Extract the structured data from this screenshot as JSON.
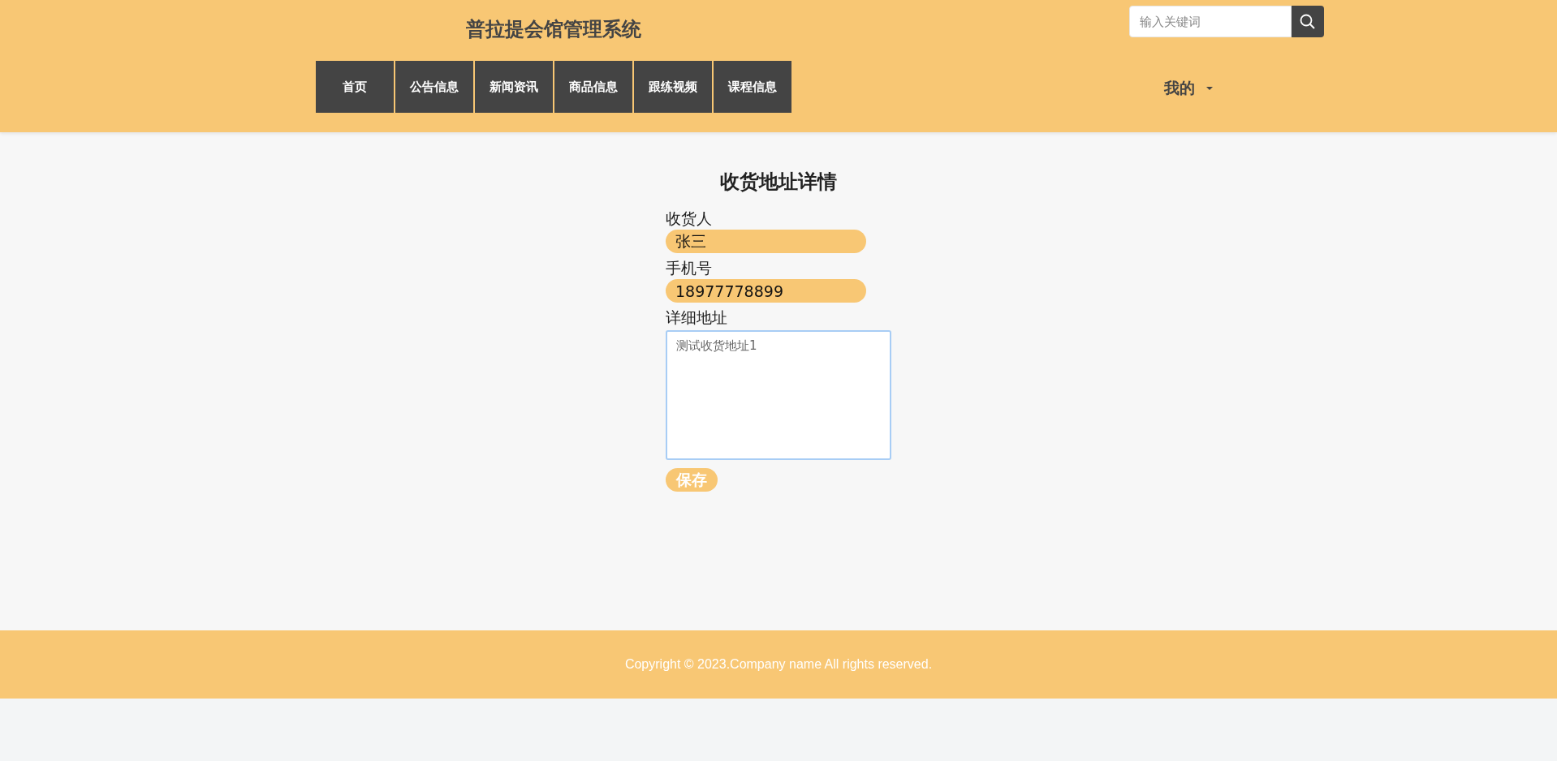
{
  "header": {
    "title": "普拉提会馆管理系统",
    "search": {
      "placeholder": "输入关键词"
    },
    "user_menu": "我的"
  },
  "nav": [
    {
      "label": "首页"
    },
    {
      "label": "公告信息"
    },
    {
      "label": "新闻资讯"
    },
    {
      "label": "商品信息"
    },
    {
      "label": "跟练视频"
    },
    {
      "label": "课程信息"
    }
  ],
  "form": {
    "title": "收货地址详情",
    "fields": [
      {
        "kind": "input",
        "label": "收货人",
        "value": "张三"
      },
      {
        "kind": "input",
        "label": "手机号",
        "value": "18977778899"
      },
      {
        "kind": "textarea",
        "label": "详细地址",
        "value": "测试收货地址1"
      }
    ],
    "save_button": "保存"
  },
  "footer": "Copyright © 2023.Company name All rights reserved."
}
